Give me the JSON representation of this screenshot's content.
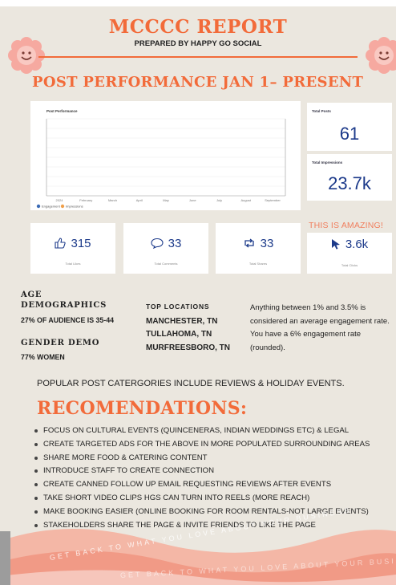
{
  "header": {
    "title": "MCCCC REPORT",
    "subtitle": "PREPARED BY HAPPY GO SOCIAL"
  },
  "section_title": "POST PERFORMANCE JAN 1– PRESENT",
  "chart": {
    "title": "Post Performance",
    "legend": [
      "Engagement",
      "Impressions"
    ],
    "x_labels": [
      "2024",
      "February",
      "March",
      "April",
      "May",
      "June",
      "July",
      "August",
      "September"
    ]
  },
  "chart_data": {
    "type": "bar",
    "title": "Post Performance",
    "series": [
      {
        "name": "Engagement",
        "color": "#3b6bb5"
      },
      {
        "name": "Impressions",
        "color": "#f0a04b"
      }
    ],
    "x": [
      "2024",
      "February",
      "March",
      "April",
      "May",
      "June",
      "July",
      "August",
      "September"
    ],
    "grid": true,
    "legend_position": "bottom-left"
  },
  "kpis": [
    {
      "label": "Total Posts",
      "value": "61"
    },
    {
      "label": "Total Impressions",
      "value": "23.7k"
    }
  ],
  "highlight": "THIS IS AMAZING!",
  "stats": [
    {
      "icon": "thumbs-up-icon",
      "value": "315",
      "label": "Total Likes"
    },
    {
      "icon": "comment-icon",
      "value": "33",
      "label": "Total Comments"
    },
    {
      "icon": "share-icon",
      "value": "33",
      "label": "Total Shares"
    },
    {
      "icon": "cursor-icon",
      "value": "3.6k",
      "label": "Total Clicks"
    }
  ],
  "demographics": {
    "age_heading_1": "AGE",
    "age_heading_2": "DEMOGRAPHICS",
    "age_text": "27% OF AUDIENCE IS 35-44",
    "gender_heading": "GENDER DEMO",
    "gender_text": "77% WOMEN"
  },
  "locations": {
    "heading": "TOP LOCATIONS",
    "items": [
      "MANCHESTER, TN",
      "TULLAHOMA, TN",
      "MURFREESBORO, TN"
    ]
  },
  "engagement_note": "Anything between 1% and 3.5% is considered an average engagement rate. You have a 6% engagement rate (rounded).",
  "popular": "POPULAR POST CATERGORIES INCLUDE REVIEWS & HOLIDAY EVENTS.",
  "recommendations": {
    "heading": "RECOMENDATIONS:",
    "items": [
      "FOCUS ON CULTURAL EVENTS (QUINCENERAS, INDIAN WEDDINGS ETC) & LEGAL",
      "CREATE TARGETED ADS FOR THE ABOVE IN MORE POPULATED SURROUNDING AREAS",
      "SHARE MORE FOOD & CATERING CONTENT",
      "INTRODUCE STAFF TO CREATE CONNECTION",
      "CREATE CANNED FOLLOW UP EMAIL REQUESTING REVIEWS AFTER EVENTS",
      "TAKE SHORT VIDEO CLIPS HGS CAN TURN INTO REELS (MORE REACH)",
      "MAKE BOOKING EASIER (ONLINE BOOKING FOR ROOM RENTALS-NOT LARGE EVENTS)",
      "STAKEHOLDERS SHARE THE PAGE & INVITE  FRIENDS TO LIKE THE PAGE"
    ]
  },
  "footer": {
    "line_1": "GET BACK TO WHAT YOU LOVE ABOUT YOUR BUSINESS",
    "line_2": "GET BACK TO WHAT YOU LOVE ABOUT YOUR BUSINESS"
  },
  "colors": {
    "accent": "#f26b3a",
    "kpi_blue": "#1c3a8a",
    "background": "#ebe7df",
    "footer_pink": "#f2b9b0"
  }
}
